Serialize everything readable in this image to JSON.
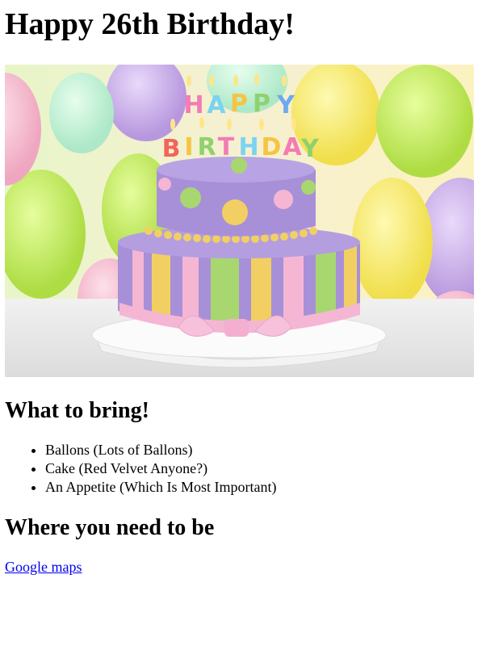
{
  "page": {
    "title": "Happy 26th Birthday!"
  },
  "hero_image": {
    "candle_text": "HAPPY BIRTHDAY",
    "colors": {
      "cake_purple": "#a890d8",
      "frosting_pink": "#f5b6d4",
      "stripe_yellow": "#f2cf62",
      "stripe_green": "#a8d770",
      "balloon_green": "#c8ef5a",
      "balloon_yellow": "#f7e760",
      "balloon_purple": "#c8a8ec",
      "balloon_pink": "#f6b0c9"
    }
  },
  "bring_section": {
    "heading": "What to bring!",
    "items": [
      "Ballons (Lots of Ballons)",
      "Cake (Red Velvet Anyone?)",
      "An Appetite (Which Is Most Important)"
    ]
  },
  "location_section": {
    "heading": "Where you need to be",
    "link_text": "Google maps"
  }
}
